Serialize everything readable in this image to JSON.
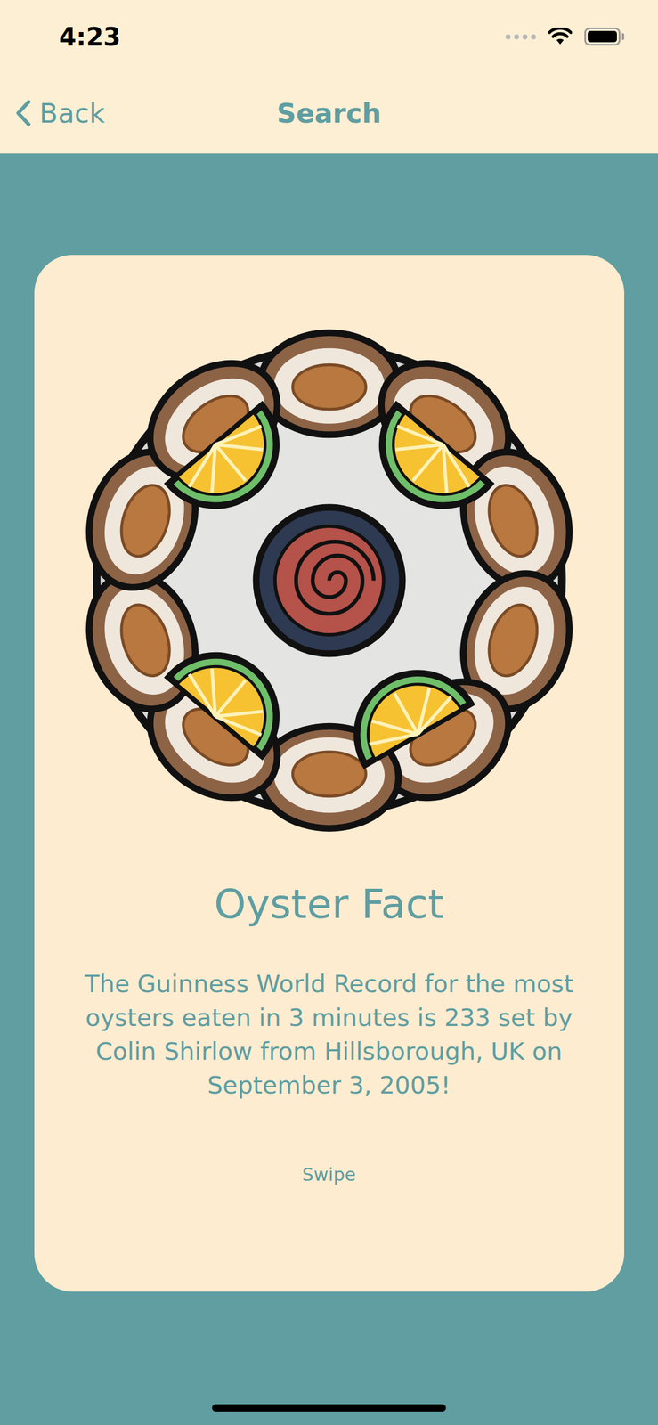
{
  "status_bar": {
    "time": "4:23",
    "signal_bars": 0,
    "battery_level": 1
  },
  "nav": {
    "back": "Back",
    "title": "Search"
  },
  "card": {
    "title": "Oyster Fact",
    "text": "The Guinness World Record for the most oysters eaten in 3 minutes is 233 set by Colin Shirlow from Hillsborough, UK on September 3, 2005!",
    "hint": "Swipe"
  }
}
